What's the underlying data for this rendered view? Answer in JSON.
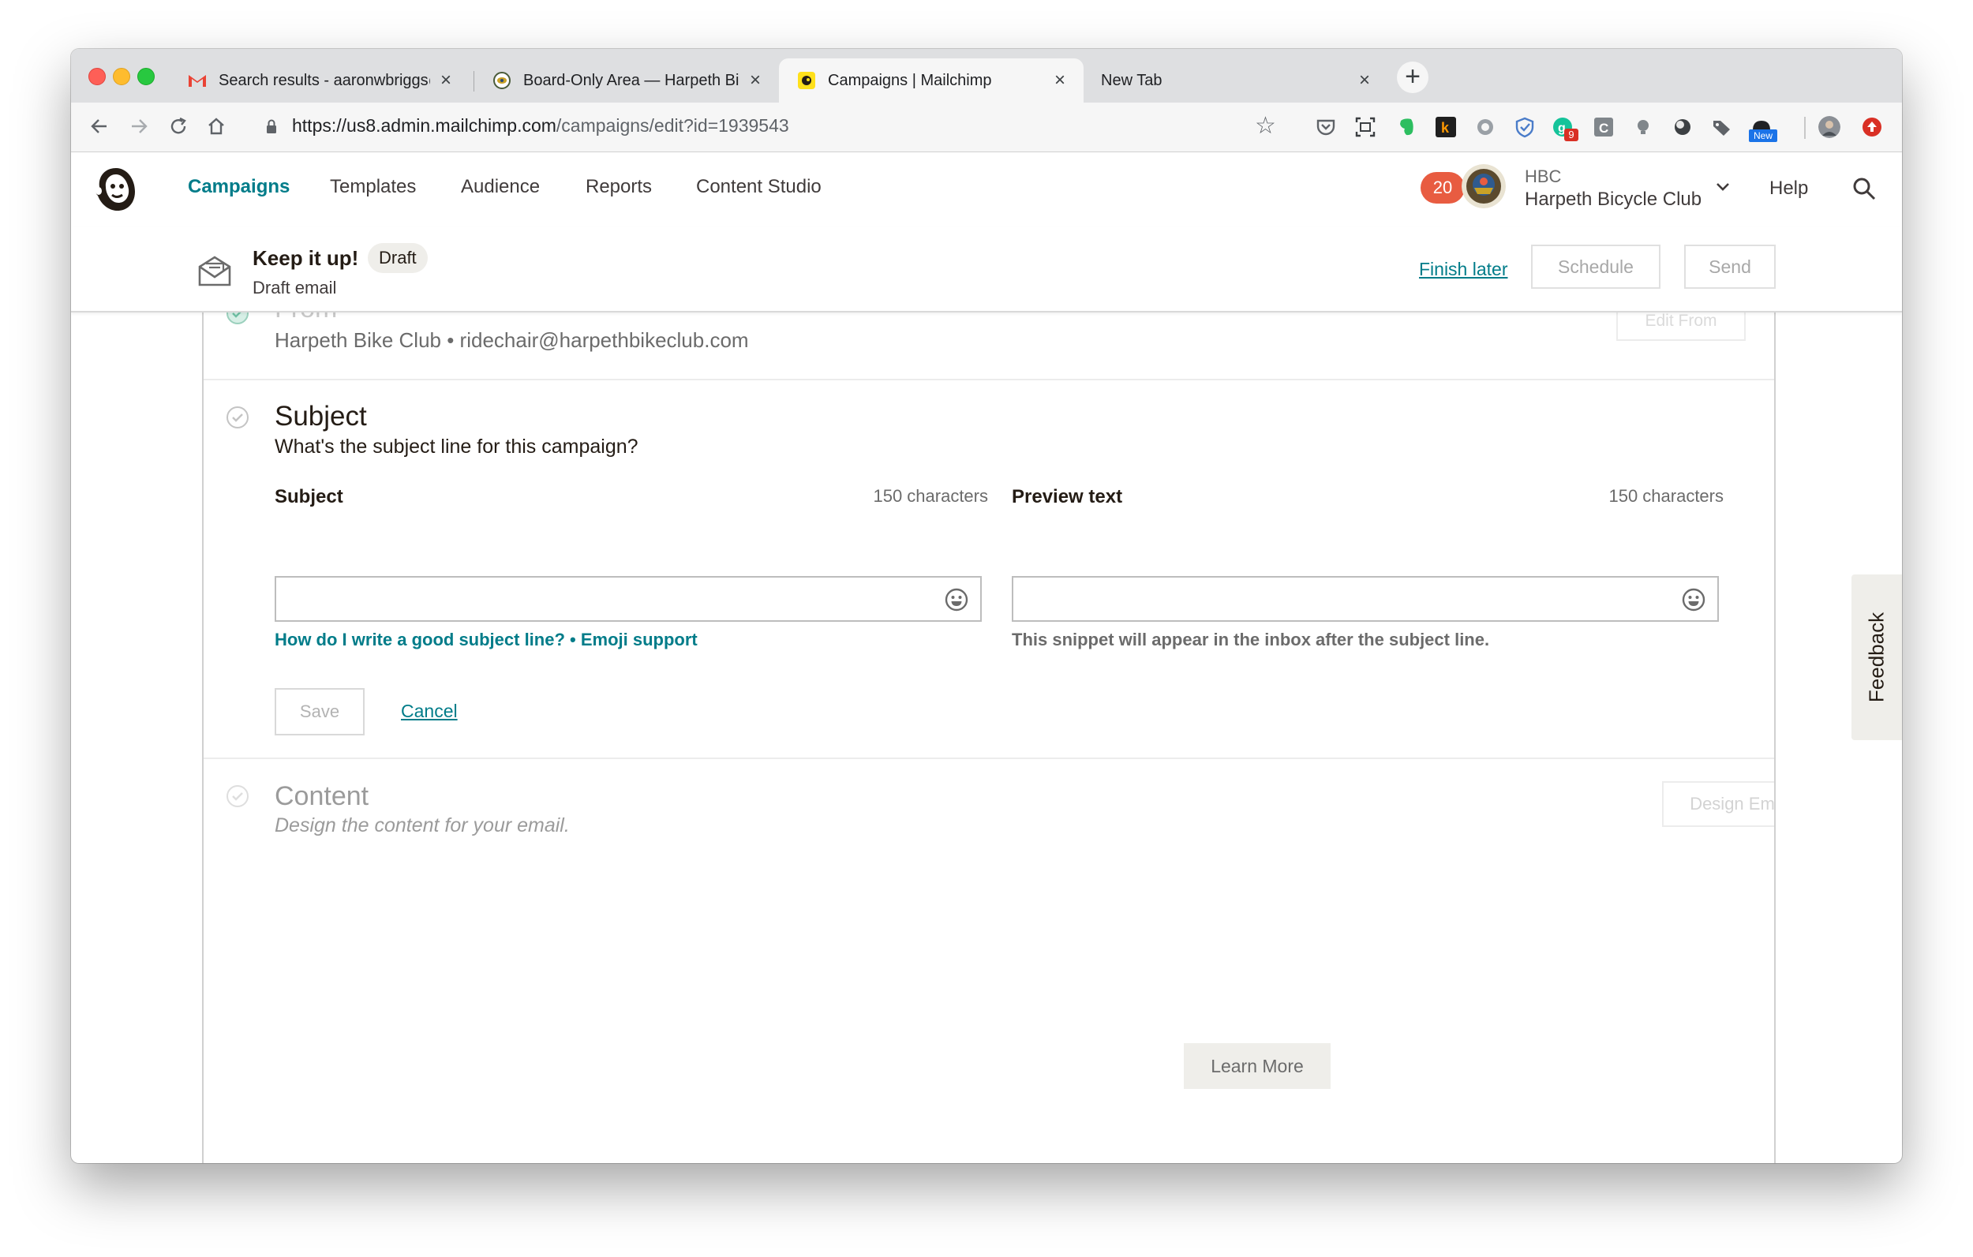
{
  "browser": {
    "tabs": [
      {
        "title": "Search results - aaronwbriggs@",
        "favicon": "gmail-icon",
        "active": false
      },
      {
        "title": "Board-Only Area — Harpeth Bi",
        "favicon": "hbc-favicon-icon",
        "active": false
      },
      {
        "title": "Campaigns | Mailchimp",
        "favicon": "mailchimp-favicon-icon",
        "active": true
      },
      {
        "title": "New Tab",
        "favicon": "",
        "active": false
      }
    ],
    "url_host": "https://us8.admin.mailchimp.com",
    "url_path": "/campaigns/edit?id=1939543",
    "extension_badge_count": "9",
    "extension_new_label": "New"
  },
  "app": {
    "nav": [
      "Campaigns",
      "Templates",
      "Audience",
      "Reports",
      "Content Studio"
    ],
    "active_nav": "Campaigns",
    "notifications_count": "20",
    "account_short": "HBC",
    "account_name": "Harpeth Bicycle Club",
    "help_label": "Help"
  },
  "campaign": {
    "title": "Keep it up!",
    "status": "Draft",
    "type": "Draft email",
    "finish_later": "Finish later",
    "schedule": "Schedule",
    "send": "Send"
  },
  "from_section": {
    "title": "From",
    "sender": "Harpeth Bike Club • ridechair@harpethbikeclub.com",
    "edit_button": "Edit From"
  },
  "subject_section": {
    "title": "Subject",
    "description": "What's the subject line for this campaign?",
    "subject_label": "Subject",
    "subject_count": "150 characters",
    "subject_value": "",
    "preview_label": "Preview text",
    "preview_count": "150 characters",
    "preview_value": "",
    "help_link": "How do I write a good subject line?",
    "link_separator": "•",
    "emoji_link": "Emoji support",
    "preview_hint": "This snippet will appear in the inbox after the subject line.",
    "save": "Save",
    "cancel": "Cancel"
  },
  "content_section": {
    "title": "Content",
    "description": "Design the content for your email.",
    "design_button": "Design Email"
  },
  "learn_more": "Learn More",
  "feedback": "Feedback",
  "colors": {
    "accent": "#007c89",
    "badge": "#e85c41",
    "ink": "#241c15"
  }
}
